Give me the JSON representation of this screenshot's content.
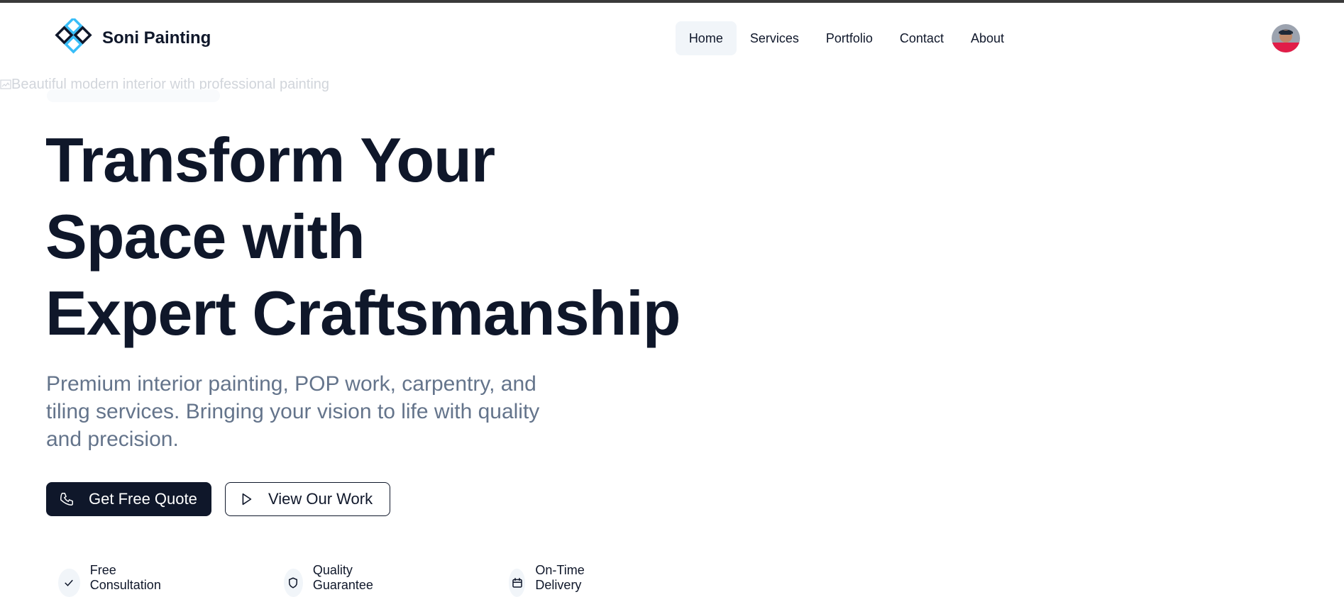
{
  "brand": {
    "name": "Soni Painting",
    "logo_icon": "diamond-logo-icon"
  },
  "nav": {
    "items": [
      {
        "label": "Home",
        "active": true
      },
      {
        "label": "Services",
        "active": false
      },
      {
        "label": "Portfolio",
        "active": false
      },
      {
        "label": "Contact",
        "active": false
      },
      {
        "label": "About",
        "active": false
      }
    ],
    "avatar_icon": "user-avatar"
  },
  "hero": {
    "image_alt": "Beautiful modern interior with professional painting",
    "title_lines": [
      "Transform Your",
      "Space with",
      "Expert Craftsmanship"
    ],
    "subtitle_lines": [
      "Premium interior painting, POP work, carpentry, and",
      "tiling services. Bringing your vision to life with quality",
      "and precision."
    ],
    "buttons": {
      "primary": {
        "label": "Get Free Quote",
        "icon": "phone-icon"
      },
      "secondary": {
        "label": "View Our Work",
        "icon": "play-icon"
      }
    }
  },
  "features": [
    {
      "label": "Free Consultation",
      "icon": "check-icon"
    },
    {
      "label": "Quality Guarantee",
      "icon": "shield-icon"
    },
    {
      "label": "On-Time Delivery",
      "icon": "calendar-icon"
    }
  ],
  "colors": {
    "primary": "#0f172a",
    "muted": "#64748b",
    "accent": "#38bdf8",
    "nav_active_bg": "#f1f5f9"
  }
}
